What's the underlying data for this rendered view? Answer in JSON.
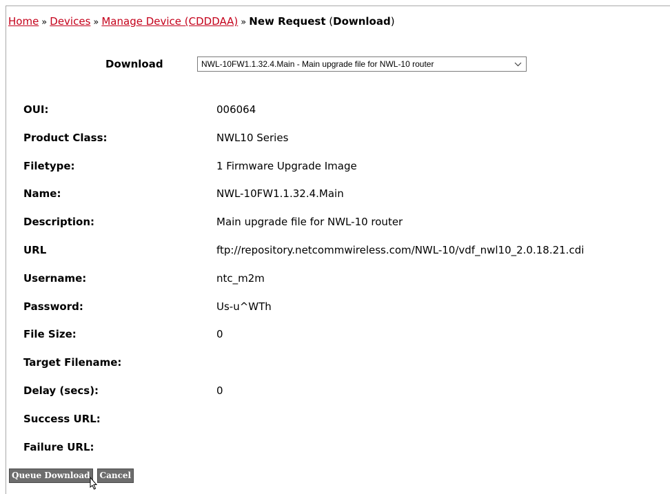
{
  "breadcrumb": {
    "home": "Home",
    "devices": "Devices",
    "manage_device": "Manage Device (CDDDAA)",
    "separator": "»",
    "current_prefix": "New Request",
    "current_suffix": "(Download)",
    "current_suffix_bold": "Download"
  },
  "download": {
    "label": "Download",
    "selected": "NWL-10FW1.1.32.4.Main - Main upgrade file for NWL-10 router"
  },
  "fields": [
    {
      "label": "OUI:",
      "value": "006064"
    },
    {
      "label": "Product Class:",
      "value": "NWL10 Series"
    },
    {
      "label": "Filetype:",
      "value": "1 Firmware Upgrade Image"
    },
    {
      "label": "Name:",
      "value": "NWL-10FW1.1.32.4.Main"
    },
    {
      "label": "Description:",
      "value": "Main upgrade file for NWL-10 router"
    },
    {
      "label": "URL",
      "value": "ftp://repository.netcommwireless.com/NWL-10/vdf_nwl10_2.0.18.21.cdi"
    },
    {
      "label": "Username:",
      "value": "ntc_m2m"
    },
    {
      "label": "Password:",
      "value": "Us-u^WTh"
    },
    {
      "label": "File Size:",
      "value": "0"
    },
    {
      "label": "Target Filename:",
      "value": ""
    },
    {
      "label": "Delay (secs):",
      "value": "0"
    },
    {
      "label": "Success URL:",
      "value": ""
    },
    {
      "label": "Failure URL:",
      "value": ""
    }
  ],
  "buttons": {
    "queue": "Queue Download",
    "cancel": "Cancel"
  },
  "colors": {
    "link": "#c4001a",
    "button_bg": "#6d6d6d"
  },
  "icons": {
    "select_arrow": "chevron-down-icon",
    "cursor": "pointer-cursor-icon"
  }
}
